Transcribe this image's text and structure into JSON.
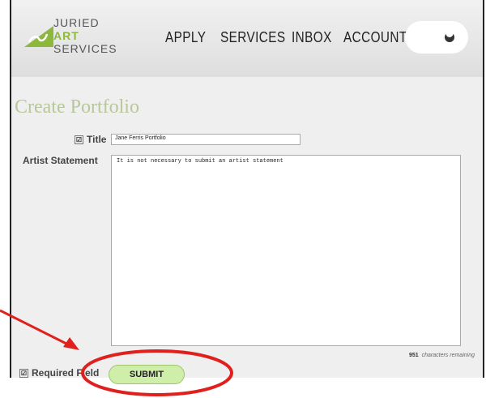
{
  "logo": {
    "line1": "JURIED",
    "line2": "ART",
    "line3": "SERVICES"
  },
  "nav": {
    "apply": "APPLY",
    "services": "SERVICES",
    "inbox": "INBOX",
    "account": "ACCOUNT"
  },
  "theme_toggle": {
    "icon": "moon-icon"
  },
  "page": {
    "title": "Create Portfolio"
  },
  "form": {
    "title_label": "Title",
    "title_value": "Jane Ferris Portfolio",
    "statement_label": "Artist Statement",
    "statement_value": "It is not necessary to submit an artist statement",
    "chars_remaining_count": "951",
    "chars_remaining_text": "characters remaining",
    "required_label": "Required Field",
    "submit_label": "SUBMIT"
  },
  "colors": {
    "accent_green": "#8cb83c",
    "annotation_red": "#e0201c",
    "submit_bg": "#cfeeaa",
    "title_color": "#b8c79a"
  }
}
